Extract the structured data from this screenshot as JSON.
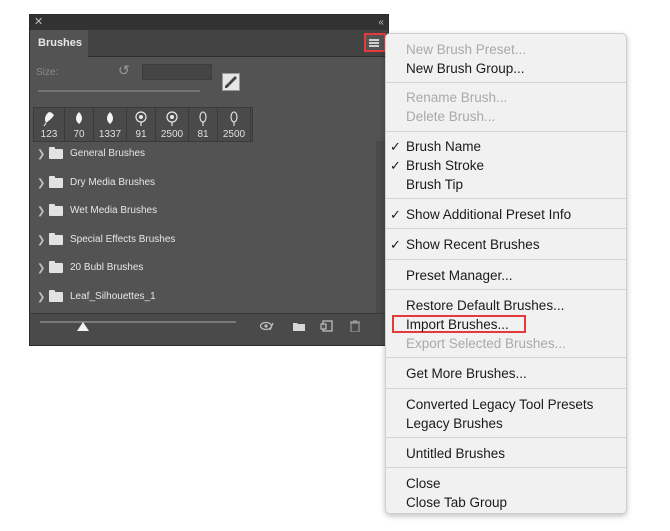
{
  "panel": {
    "tab_label": "Brushes",
    "size_label": "Size:",
    "recent_brushes": [
      {
        "size": "123",
        "shape": "leaf-white"
      },
      {
        "size": "70",
        "shape": "leaf-drop"
      },
      {
        "size": "1337",
        "shape": "leaf-drop"
      },
      {
        "size": "91",
        "shape": "bulb"
      },
      {
        "size": "2500",
        "shape": "bulb"
      },
      {
        "size": "81",
        "shape": "bulb-thin"
      },
      {
        "size": "2500",
        "shape": "bulb-thin"
      }
    ],
    "groups": [
      "General Brushes",
      "Dry Media Brushes",
      "Wet Media Brushes",
      "Special Effects Brushes",
      "20 Bubl Brushes",
      "Leaf_Silhouettes_1"
    ],
    "preview_zoom": 0.22
  },
  "menu": {
    "items": [
      {
        "label": "New Brush Preset...",
        "enabled": false,
        "checked": false
      },
      {
        "label": "New Brush Group...",
        "enabled": true,
        "checked": false
      },
      {
        "label": "Rename Brush...",
        "enabled": false,
        "checked": false
      },
      {
        "label": "Delete Brush...",
        "enabled": false,
        "checked": false
      },
      {
        "label": "Brush Name",
        "enabled": true,
        "checked": true
      },
      {
        "label": "Brush Stroke",
        "enabled": true,
        "checked": true
      },
      {
        "label": "Brush Tip",
        "enabled": true,
        "checked": false
      },
      {
        "label": "Show Additional Preset Info",
        "enabled": true,
        "checked": true
      },
      {
        "label": "Show Recent Brushes",
        "enabled": true,
        "checked": true
      },
      {
        "label": "Preset Manager...",
        "enabled": true,
        "checked": false
      },
      {
        "label": "Restore Default Brushes...",
        "enabled": true,
        "checked": false
      },
      {
        "label": "Import Brushes...",
        "enabled": true,
        "checked": false,
        "highlighted": true
      },
      {
        "label": "Export Selected Brushes...",
        "enabled": false,
        "checked": false
      },
      {
        "label": "Get More Brushes...",
        "enabled": true,
        "checked": false
      },
      {
        "label": "Converted Legacy Tool Presets",
        "enabled": true,
        "checked": false
      },
      {
        "label": "Legacy Brushes",
        "enabled": true,
        "checked": false
      },
      {
        "label": "Untitled Brushes",
        "enabled": true,
        "checked": false
      },
      {
        "label": "Close",
        "enabled": true,
        "checked": false
      },
      {
        "label": "Close Tab Group",
        "enabled": true,
        "checked": false
      }
    ],
    "check_glyph": "✓",
    "highlight_color": "#e33a3a"
  }
}
